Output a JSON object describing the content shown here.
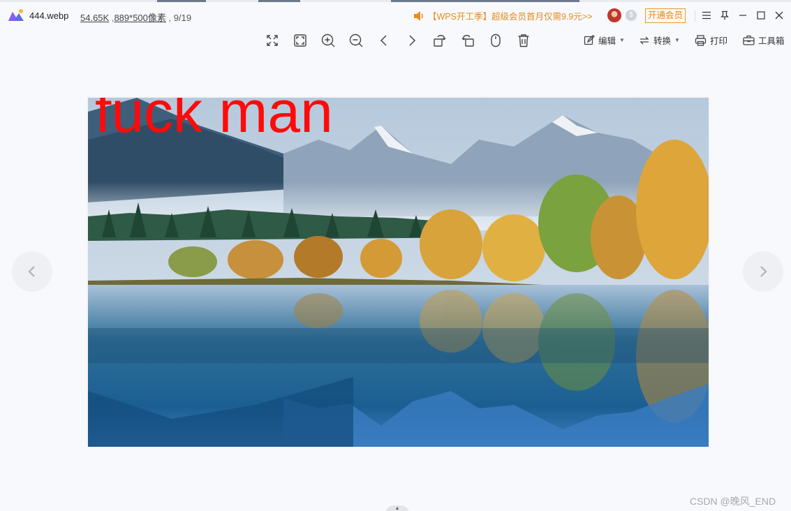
{
  "titlebar": {
    "filename": "444.webp",
    "filesize": "54.65K",
    "dimensions": "889*500像素",
    "index": "9/19",
    "promo_text": "【WPS开工季】超级会员首月仅需9.9元>>",
    "vip_button": "开通会员",
    "window_icons": [
      "menu-icon",
      "pin-icon",
      "minimize-icon",
      "maximize-icon",
      "close-icon"
    ]
  },
  "toolbar": {
    "icons": [
      "fit-screen-icon",
      "actual-size-icon",
      "zoom-in-icon",
      "zoom-out-icon",
      "previous-icon",
      "next-icon",
      "rotate-left-icon",
      "rotate-right-icon",
      "mouse-icon",
      "delete-icon"
    ],
    "edit_label": "编辑",
    "convert_label": "转换",
    "print_label": "打印",
    "tools_label": "工具箱"
  },
  "image": {
    "overlay_text": "fuck man",
    "overlay_color": "#ff0a0a"
  },
  "watermark": "CSDN @晚风_END",
  "colors": {
    "accent": "#e68a1f",
    "background": "#f8f9fc"
  }
}
